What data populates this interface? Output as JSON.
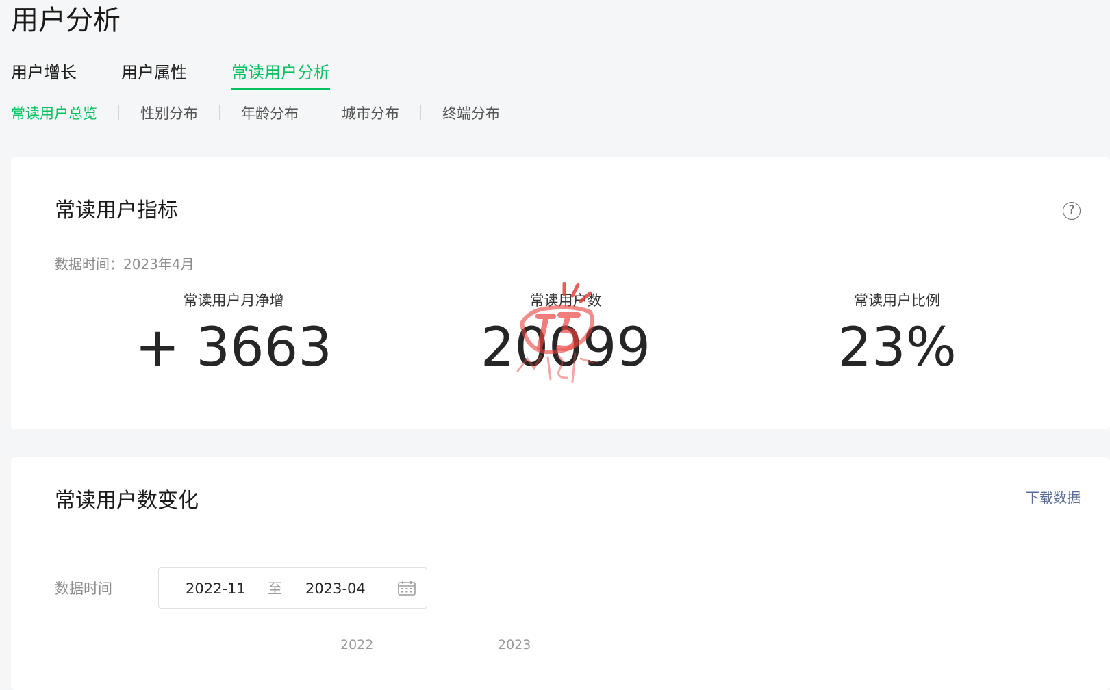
{
  "page": {
    "title": "用户分析"
  },
  "main_tabs": [
    {
      "label": "用户增长",
      "active": false
    },
    {
      "label": "用户属性",
      "active": false
    },
    {
      "label": "常读用户分析",
      "active": true
    }
  ],
  "sub_tabs": [
    {
      "label": "常读用户总览",
      "active": true
    },
    {
      "label": "性别分布",
      "active": false
    },
    {
      "label": "年龄分布",
      "active": false
    },
    {
      "label": "城市分布",
      "active": false
    },
    {
      "label": "终端分布",
      "active": false
    }
  ],
  "metrics_card": {
    "title": "常读用户指标",
    "help_icon": "question-circle-icon",
    "data_time": "数据时间：2023年4月",
    "metrics": [
      {
        "label": "常读用户月净增",
        "prefix": "+",
        "value": "3663"
      },
      {
        "label": "常读用户数",
        "value": "20099"
      },
      {
        "label": "常读用户比例",
        "value": "23%"
      }
    ]
  },
  "trend_card": {
    "title": "常读用户数变化",
    "download_label": "下载数据",
    "filter_label": "数据时间",
    "range_start": "2022-11",
    "range_separator": "至",
    "range_end": "2023-04",
    "calendar_icon": "calendar-icon",
    "year_labels": [
      "2022",
      "2023"
    ]
  },
  "colors": {
    "accent": "#07c160",
    "link": "#576b95",
    "watermark": "#e8413c"
  }
}
